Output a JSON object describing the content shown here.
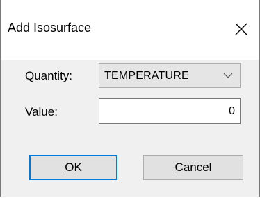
{
  "window": {
    "title": "Add Isosurface",
    "close_icon": "close-icon"
  },
  "form": {
    "quantity_label": "Quantity:",
    "quantity_value": "TEMPERATURE",
    "quantity_icon": "chevron-down-icon",
    "value_label": "Value:",
    "value_input": "0"
  },
  "buttons": {
    "ok_mnemonic": "O",
    "ok_rest": "K",
    "cancel_mnemonic": "C",
    "cancel_rest": "ancel"
  },
  "colors": {
    "focus_border": "#0078d7",
    "dialog_background": "#f0f0f0",
    "titlebar_background": "#ffffff"
  }
}
